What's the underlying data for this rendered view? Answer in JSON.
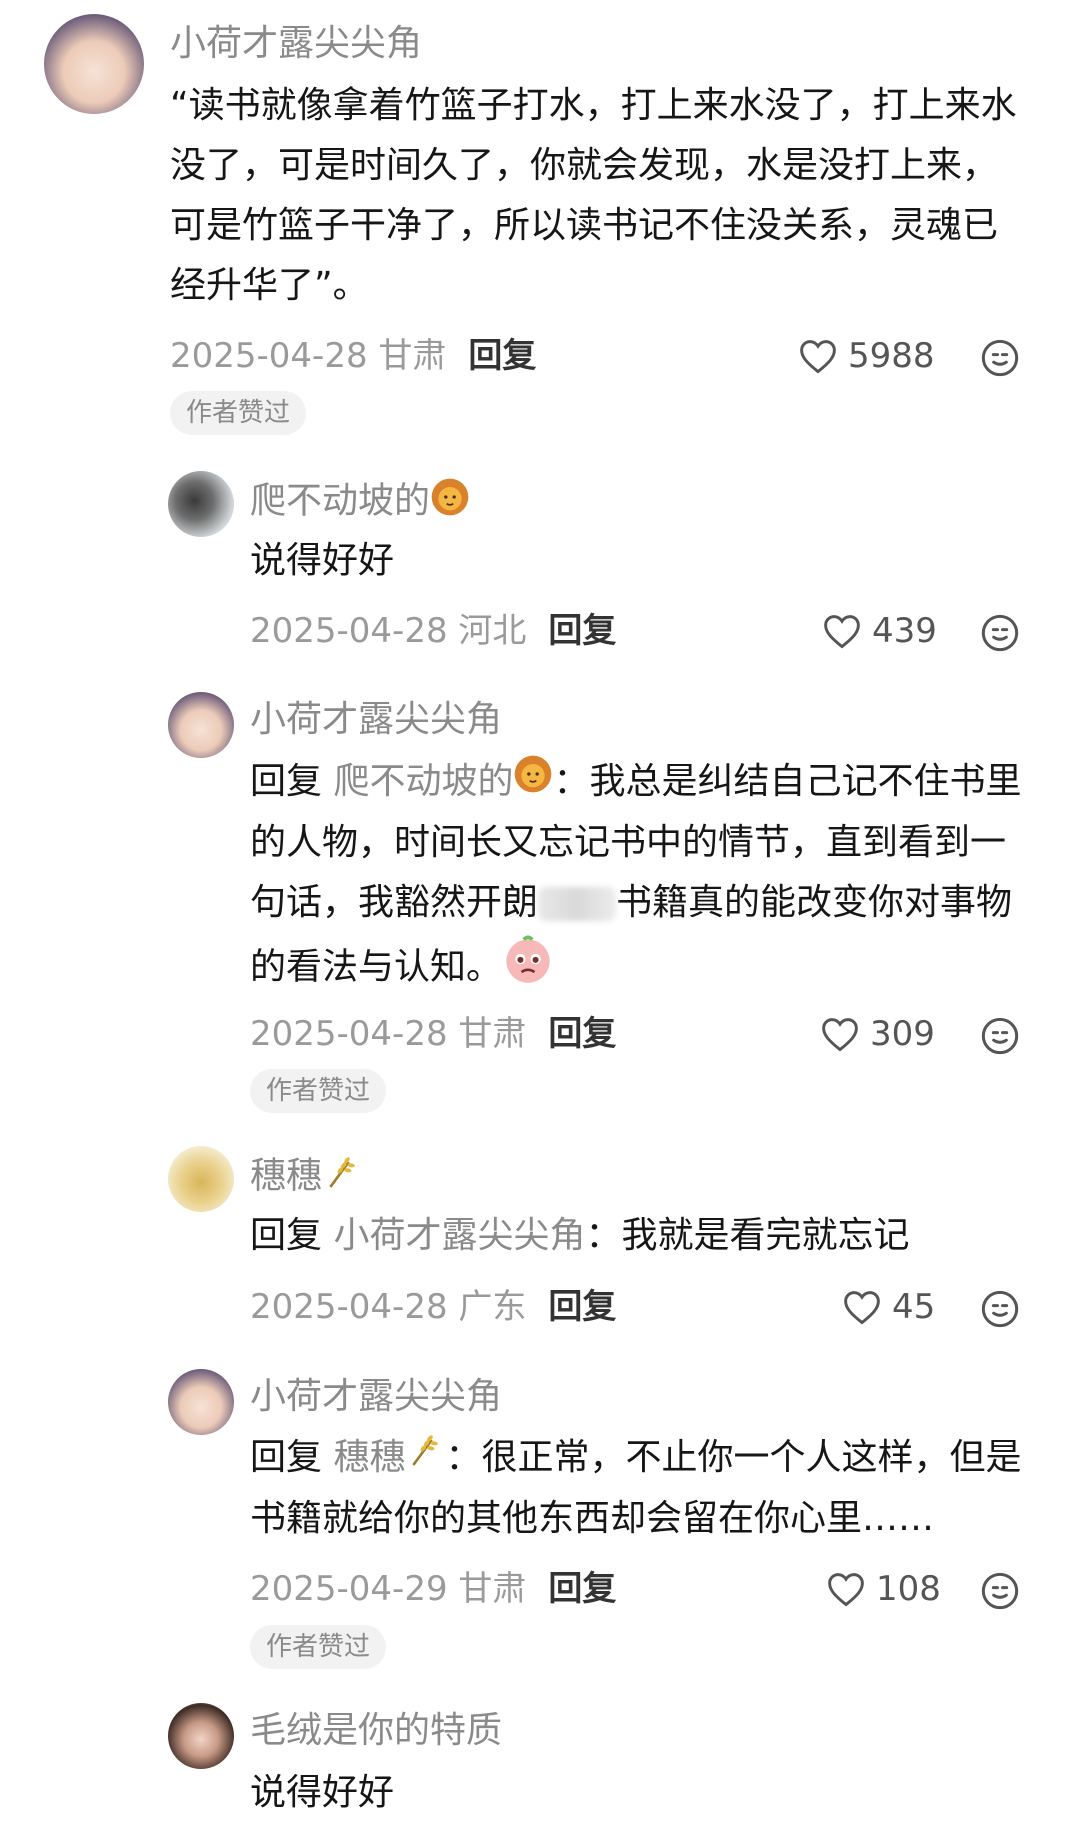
{
  "comments": [
    {
      "author": "小荷才露尖尖角",
      "text": "“读书就像拿着竹篮子打水，打上来水没了，打上来水没了，可是时间久了，你就会发现，水是没打上来，可是竹篮子干净了，所以读书记不住没关系，灵魂已经升华了”。",
      "date_loc": "2025-04-28 甘肃",
      "reply_label": "回复",
      "likes": "5988",
      "badge": "作者赞过"
    }
  ],
  "replies": [
    {
      "author": "爬不动坡的",
      "author_emoji": "lion",
      "text": "说得好好",
      "date_loc": "2025-04-28 河北",
      "reply_label": "回复",
      "likes": "439"
    },
    {
      "author": "小荷才露尖尖角",
      "reply_prefix": "回复",
      "reply_to": "爬不动坡的",
      "reply_to_emoji": "lion",
      "text_a": "：我总是纠结自己记不住书里的人物，时间长又忘记书中的情节，直到看到一句话，我豁然开朗",
      "text_b": "书籍真的能改变你对事物的看法与认知。",
      "text_emoji": "pleading-face",
      "date_loc": "2025-04-28 甘肃",
      "reply_label": "回复",
      "likes": "309",
      "badge": "作者赞过"
    },
    {
      "author": "穗穗",
      "author_emoji": "wheat",
      "reply_prefix": "回复",
      "reply_to": "小荷才露尖尖角",
      "text": "：我就是看完就忘记",
      "date_loc": "2025-04-28 广东",
      "reply_label": "回复",
      "likes": "45"
    },
    {
      "author": "小荷才露尖尖角",
      "reply_prefix": "回复",
      "reply_to": "穗穗",
      "reply_to_emoji": "wheat",
      "text": "：很正常，不止你一个人这样，但是书籍就给你的其他东西却会留在你心里……",
      "date_loc": "2025-04-29 甘肃",
      "reply_label": "回复",
      "likes": "108",
      "badge": "作者赞过"
    },
    {
      "author": "毛绒是你的特质",
      "text": "说得好好"
    }
  ],
  "icons": {
    "like": "heart-outline-icon",
    "emoji": "emoji-face-icon"
  }
}
